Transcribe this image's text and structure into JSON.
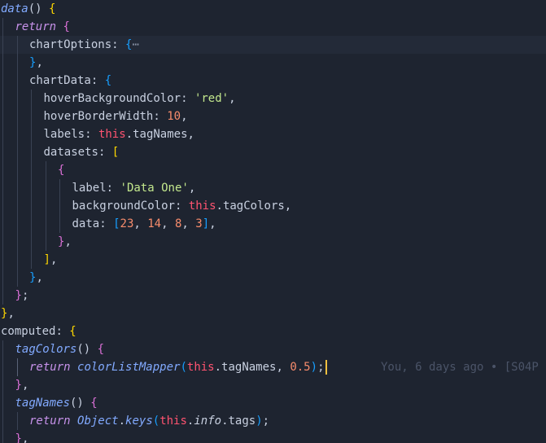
{
  "lines": [
    {
      "indent": 0,
      "tokens": [
        [
          "data",
          "t-fn"
        ],
        [
          "()",
          "t-plain"
        ],
        [
          " ",
          "t-plain"
        ],
        [
          "{",
          "t-brace1"
        ]
      ]
    },
    {
      "indent": 1,
      "tokens": [
        [
          "return",
          "t-kw"
        ],
        [
          " ",
          "t-plain"
        ],
        [
          "{",
          "t-brace2"
        ]
      ]
    },
    {
      "indent": 2,
      "highlight": true,
      "tokens": [
        [
          "chartOptions",
          "t-prop"
        ],
        [
          ": ",
          "t-plain"
        ],
        [
          "{",
          "t-brace3"
        ],
        [
          "⋯",
          "t-fold"
        ]
      ]
    },
    {
      "indent": 2,
      "tokens": [
        [
          "}",
          "t-brace3"
        ],
        [
          ",",
          "t-plain"
        ]
      ]
    },
    {
      "indent": 2,
      "tokens": [
        [
          "chartData",
          "t-prop"
        ],
        [
          ": ",
          "t-plain"
        ],
        [
          "{",
          "t-brace3"
        ]
      ]
    },
    {
      "indent": 3,
      "tokens": [
        [
          "hoverBackgroundColor",
          "t-prop"
        ],
        [
          ": ",
          "t-plain"
        ],
        [
          "'red'",
          "t-str"
        ],
        [
          ",",
          "t-plain"
        ]
      ]
    },
    {
      "indent": 3,
      "tokens": [
        [
          "hoverBorderWidth",
          "t-prop"
        ],
        [
          ": ",
          "t-plain"
        ],
        [
          "10",
          "t-num"
        ],
        [
          ",",
          "t-plain"
        ]
      ]
    },
    {
      "indent": 3,
      "tokens": [
        [
          "labels",
          "t-prop"
        ],
        [
          ": ",
          "t-plain"
        ],
        [
          "this",
          "t-this"
        ],
        [
          ".tagNames,",
          "t-plain"
        ]
      ]
    },
    {
      "indent": 3,
      "tokens": [
        [
          "datasets",
          "t-prop"
        ],
        [
          ": ",
          "t-plain"
        ],
        [
          "[",
          "t-brace1"
        ]
      ]
    },
    {
      "indent": 4,
      "tokens": [
        [
          "{",
          "t-brace2"
        ]
      ]
    },
    {
      "indent": 5,
      "tokens": [
        [
          "label",
          "t-prop"
        ],
        [
          ": ",
          "t-plain"
        ],
        [
          "'Data One'",
          "t-str"
        ],
        [
          ",",
          "t-plain"
        ]
      ]
    },
    {
      "indent": 5,
      "tokens": [
        [
          "backgroundColor",
          "t-prop"
        ],
        [
          ": ",
          "t-plain"
        ],
        [
          "this",
          "t-this"
        ],
        [
          ".tagColors,",
          "t-plain"
        ]
      ]
    },
    {
      "indent": 5,
      "tokens": [
        [
          "data",
          "t-prop"
        ],
        [
          ": ",
          "t-plain"
        ],
        [
          "[",
          "t-brace3"
        ],
        [
          "23",
          "t-num"
        ],
        [
          ", ",
          "t-plain"
        ],
        [
          "14",
          "t-num"
        ],
        [
          ", ",
          "t-plain"
        ],
        [
          "8",
          "t-num"
        ],
        [
          ", ",
          "t-plain"
        ],
        [
          "3",
          "t-num"
        ],
        [
          "]",
          "t-brace3"
        ],
        [
          ",",
          "t-plain"
        ]
      ]
    },
    {
      "indent": 4,
      "tokens": [
        [
          "}",
          "t-brace2"
        ],
        [
          ",",
          "t-plain"
        ]
      ]
    },
    {
      "indent": 3,
      "tokens": [
        [
          "]",
          "t-brace1"
        ],
        [
          ",",
          "t-plain"
        ]
      ]
    },
    {
      "indent": 2,
      "tokens": [
        [
          "}",
          "t-brace3"
        ],
        [
          ",",
          "t-plain"
        ]
      ]
    },
    {
      "indent": 1,
      "tokens": [
        [
          "}",
          "t-brace2"
        ],
        [
          ";",
          "t-plain"
        ]
      ]
    },
    {
      "indent": 0,
      "tokens": [
        [
          "}",
          "t-brace1"
        ],
        [
          ",",
          "t-plain"
        ]
      ]
    },
    {
      "indent": 0,
      "tokens": [
        [
          "computed",
          "t-prop"
        ],
        [
          ": ",
          "t-plain"
        ],
        [
          "{",
          "t-brace1"
        ]
      ]
    },
    {
      "indent": 1,
      "tokens": [
        [
          "tagColors",
          "t-fn"
        ],
        [
          "() ",
          "t-plain"
        ],
        [
          "{",
          "t-brace2"
        ]
      ]
    },
    {
      "indent": 2,
      "cursor": true,
      "blame": "You, 6 days ago • [S04P",
      "tokens": [
        [
          "return",
          "t-kw"
        ],
        [
          " ",
          "t-plain"
        ],
        [
          "colorListMapper",
          "t-fn"
        ],
        [
          "(",
          "t-brace3"
        ],
        [
          "this",
          "t-this"
        ],
        [
          ".tagNames, ",
          "t-plain"
        ],
        [
          "0.5",
          "t-num"
        ],
        [
          ")",
          "t-brace3"
        ],
        [
          ";",
          "t-plain"
        ]
      ]
    },
    {
      "indent": 1,
      "tokens": [
        [
          "}",
          "t-brace2"
        ],
        [
          ",",
          "t-plain"
        ]
      ]
    },
    {
      "indent": 1,
      "tokens": [
        [
          "tagNames",
          "t-fn"
        ],
        [
          "() ",
          "t-plain"
        ],
        [
          "{",
          "t-brace2"
        ]
      ]
    },
    {
      "indent": 2,
      "tokens": [
        [
          "return",
          "t-kw"
        ],
        [
          " ",
          "t-plain"
        ],
        [
          "Object",
          "t-fn"
        ],
        [
          ".",
          "t-plain"
        ],
        [
          "keys",
          "t-fn"
        ],
        [
          "(",
          "t-brace3"
        ],
        [
          "this",
          "t-this"
        ],
        [
          ".",
          "t-plain"
        ],
        [
          "info",
          "t-italic"
        ],
        [
          ".tags",
          "t-plain"
        ],
        [
          ")",
          "t-brace3"
        ],
        [
          ";",
          "t-plain"
        ]
      ]
    },
    {
      "indent": 1,
      "tokens": [
        [
          "}",
          "t-brace2"
        ],
        [
          ",",
          "t-plain"
        ]
      ]
    }
  ]
}
